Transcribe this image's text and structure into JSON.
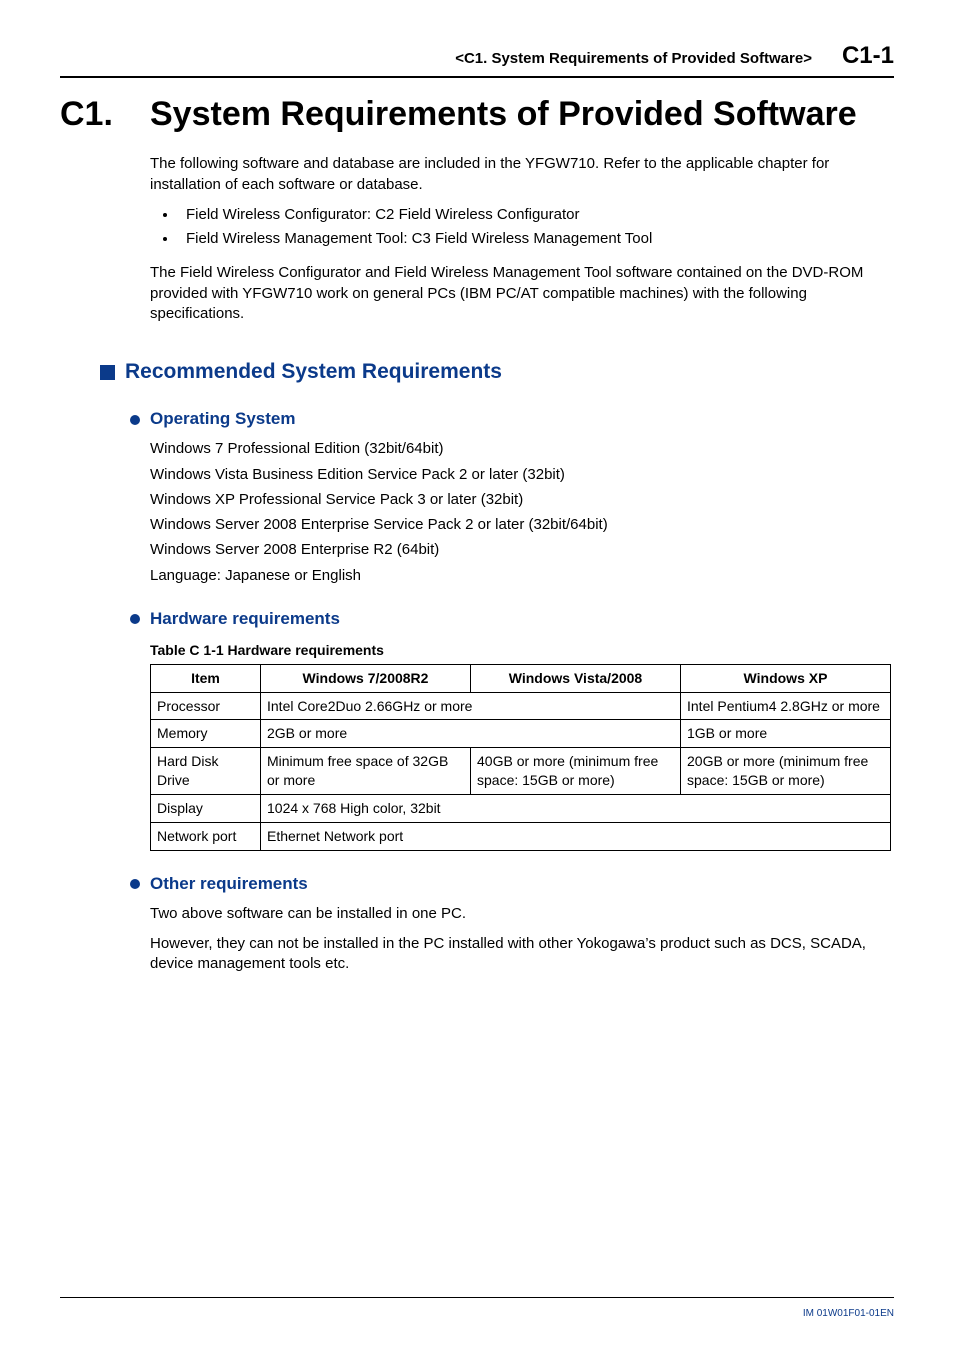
{
  "header": {
    "running_title": "<C1.  System Requirements of Provided Software>",
    "page_number": "C1-1"
  },
  "title": {
    "number": "C1.",
    "text": "System Requirements of Provided Software"
  },
  "intro": {
    "p1": "The following software and database are included in the YFGW710. Refer to the applicable chapter for installation of each software or database.",
    "bullets": [
      "Field Wireless Configurator: C2 Field Wireless Configurator",
      "Field Wireless Management Tool: C3 Field Wireless Management Tool"
    ],
    "p2": "The Field Wireless Configurator and Field Wireless Management Tool software contained on the DVD-ROM provided with YFGW710 work on general PCs (IBM PC/AT compatible machines) with the following specifications."
  },
  "section_h2": "Recommended System Requirements",
  "os": {
    "heading": "Operating System",
    "lines": [
      "Windows 7 Professional Edition (32bit/64bit)",
      "Windows Vista Business Edition Service Pack 2 or later (32bit)",
      "Windows XP Professional Service Pack 3 or later (32bit)",
      "Windows Server 2008 Enterprise Service Pack 2 or later (32bit/64bit)",
      "Windows Server 2008 Enterprise R2 (64bit)",
      "Language: Japanese or English"
    ]
  },
  "hw": {
    "heading": "Hardware requirements",
    "caption": "Table C 1-1 Hardware requirements",
    "cols": {
      "item": "Item",
      "a": "Windows 7/2008R2",
      "b": "Windows Vista/2008",
      "c": "Windows XP"
    },
    "rows": {
      "processor": {
        "item": "Processor",
        "ab": "Intel Core2Duo 2.66GHz or more",
        "c": "Intel Pentium4 2.8GHz or more"
      },
      "memory": {
        "item": "Memory",
        "ab": "2GB or more",
        "c": "1GB or more"
      },
      "hdd": {
        "item": "Hard Disk Drive",
        "a": "Minimum free space of 32GB or more",
        "b": "40GB or more (minimum free space: 15GB or more)",
        "c": "20GB or more (minimum free space: 15GB or more)"
      },
      "display": {
        "item": "Display",
        "abc": "1024 x 768 High color, 32bit"
      },
      "network": {
        "item": "Network port",
        "abc": "Ethernet Network port"
      }
    }
  },
  "other": {
    "heading": "Other requirements",
    "p1": "Two above software can be installed in one PC.",
    "p2": "However, they can not be installed in the PC installed with other Yokogawa’s product such as DCS, SCADA, device management tools etc."
  },
  "footer": {
    "doc_id": "IM 01W01F01-01EN"
  }
}
